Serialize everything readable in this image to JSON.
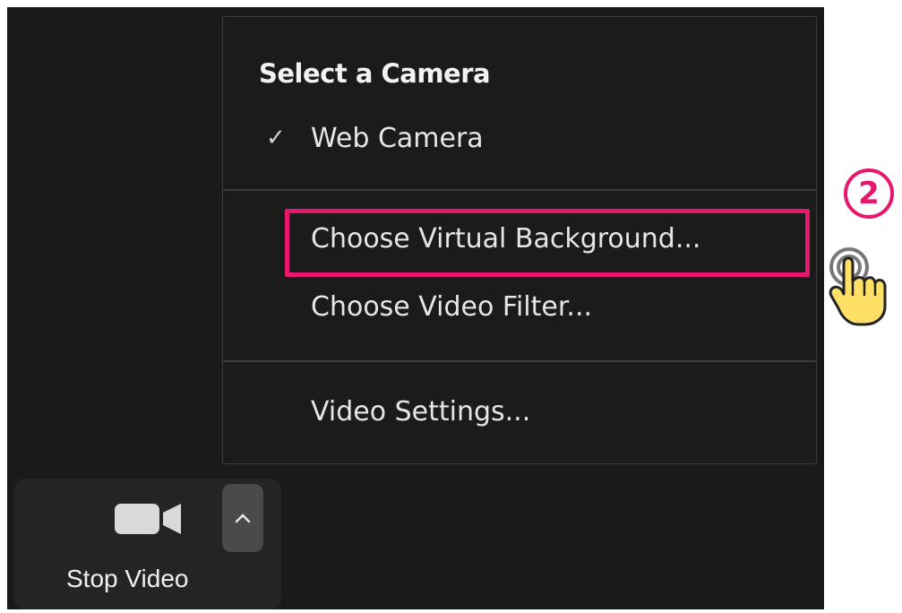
{
  "menu": {
    "header": "Select a Camera",
    "camera_item": "Web Camera",
    "check_mark": "✓",
    "virtual_bg_item": "Choose Virtual Background...",
    "video_filter_item": "Choose Video Filter...",
    "video_settings_item": "Video Settings..."
  },
  "toolbar": {
    "stop_video_label": "Stop Video",
    "caret": "^"
  },
  "annotation": {
    "step_number": "2",
    "highlight_color": "#e8176e"
  },
  "icons": {
    "camera": "video-camera-icon",
    "caret": "caret-up-icon",
    "hand": "pointing-hand-icon"
  }
}
